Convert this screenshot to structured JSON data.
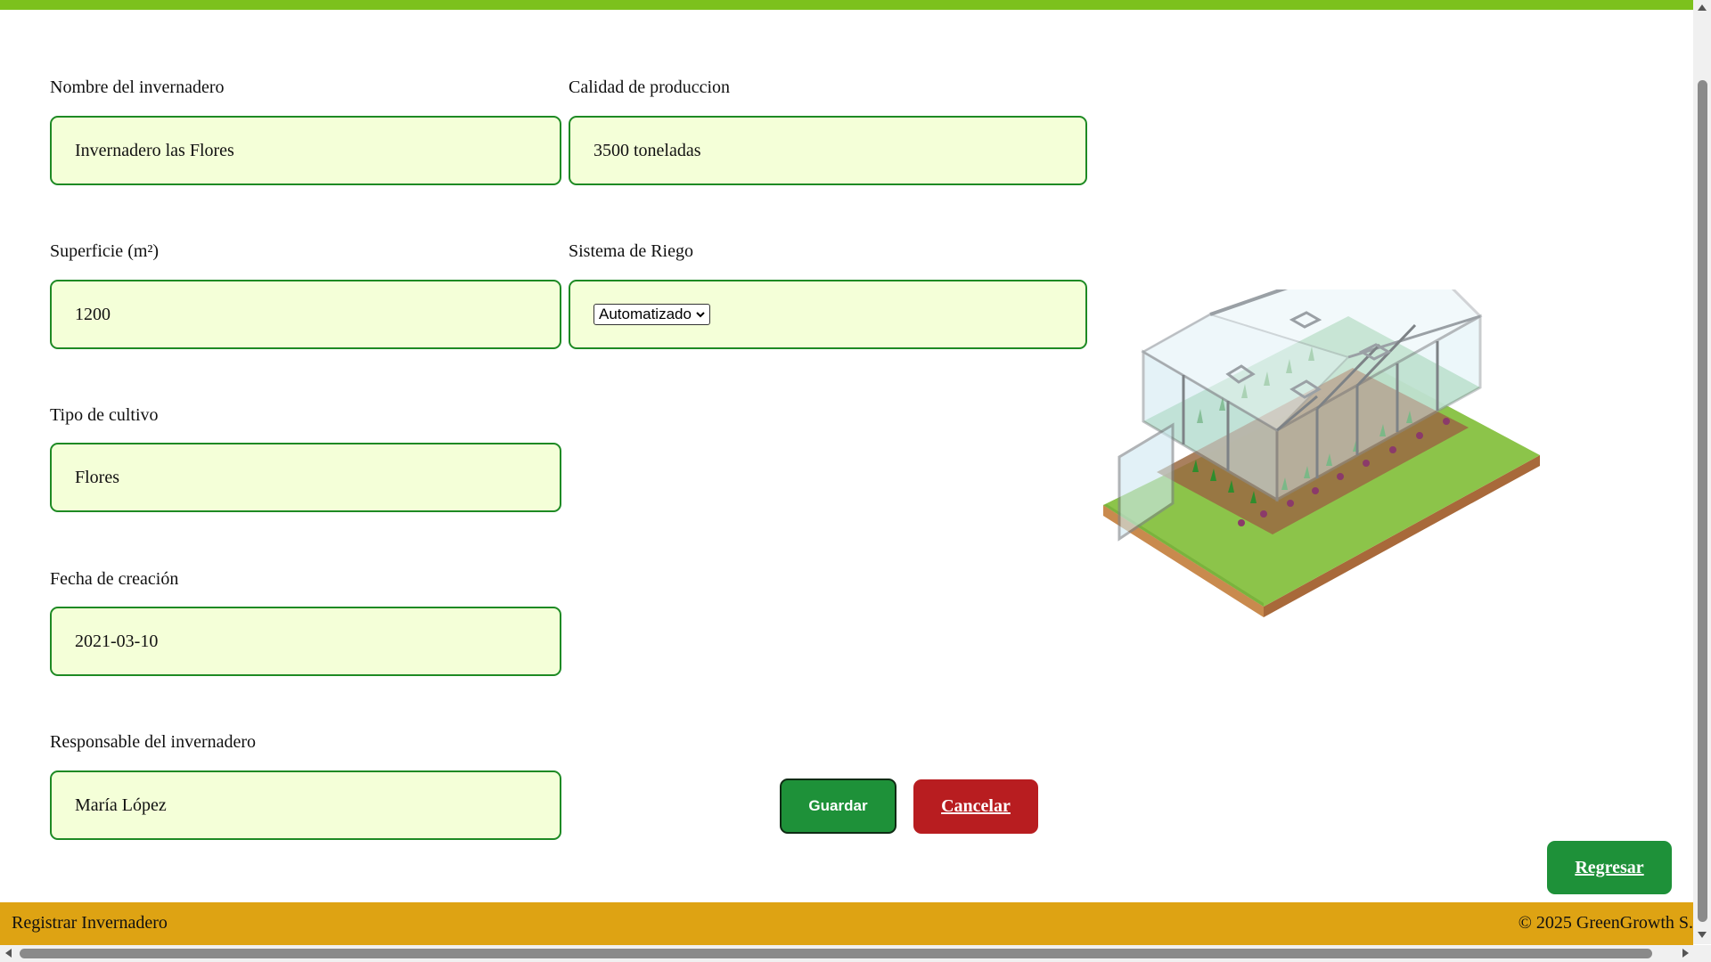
{
  "form": {
    "nombre": {
      "label": "Nombre del invernadero",
      "value": "Invernadero las Flores"
    },
    "calidad": {
      "label": "Calidad de produccion",
      "value": "3500 toneladas"
    },
    "superficie": {
      "label": "Superficie (m²)",
      "value": "1200"
    },
    "riego": {
      "label": "Sistema de Riego",
      "selected": "Automatizado"
    },
    "cultivo": {
      "label": "Tipo de cultivo",
      "value": "Flores"
    },
    "fecha": {
      "label": "Fecha de creación",
      "value": "2021-03-10"
    },
    "responsable": {
      "label": "Responsable del invernadero",
      "value": "María López"
    }
  },
  "actions": {
    "save_label": "Guardar",
    "cancel_label": "Cancelar",
    "back_label": "Regresar"
  },
  "footer": {
    "left": "Registrar Invernadero",
    "right": "© 2025 GreenGrowth S."
  },
  "colors": {
    "accent_top": "#7cc11d",
    "field_bg": "#f4ffd8",
    "field_border": "#1e8a24",
    "save": "#1e9139",
    "cancel": "#b81d20",
    "footer": "#dea313"
  },
  "illustration": {
    "icon": "greenhouse-illustration"
  }
}
